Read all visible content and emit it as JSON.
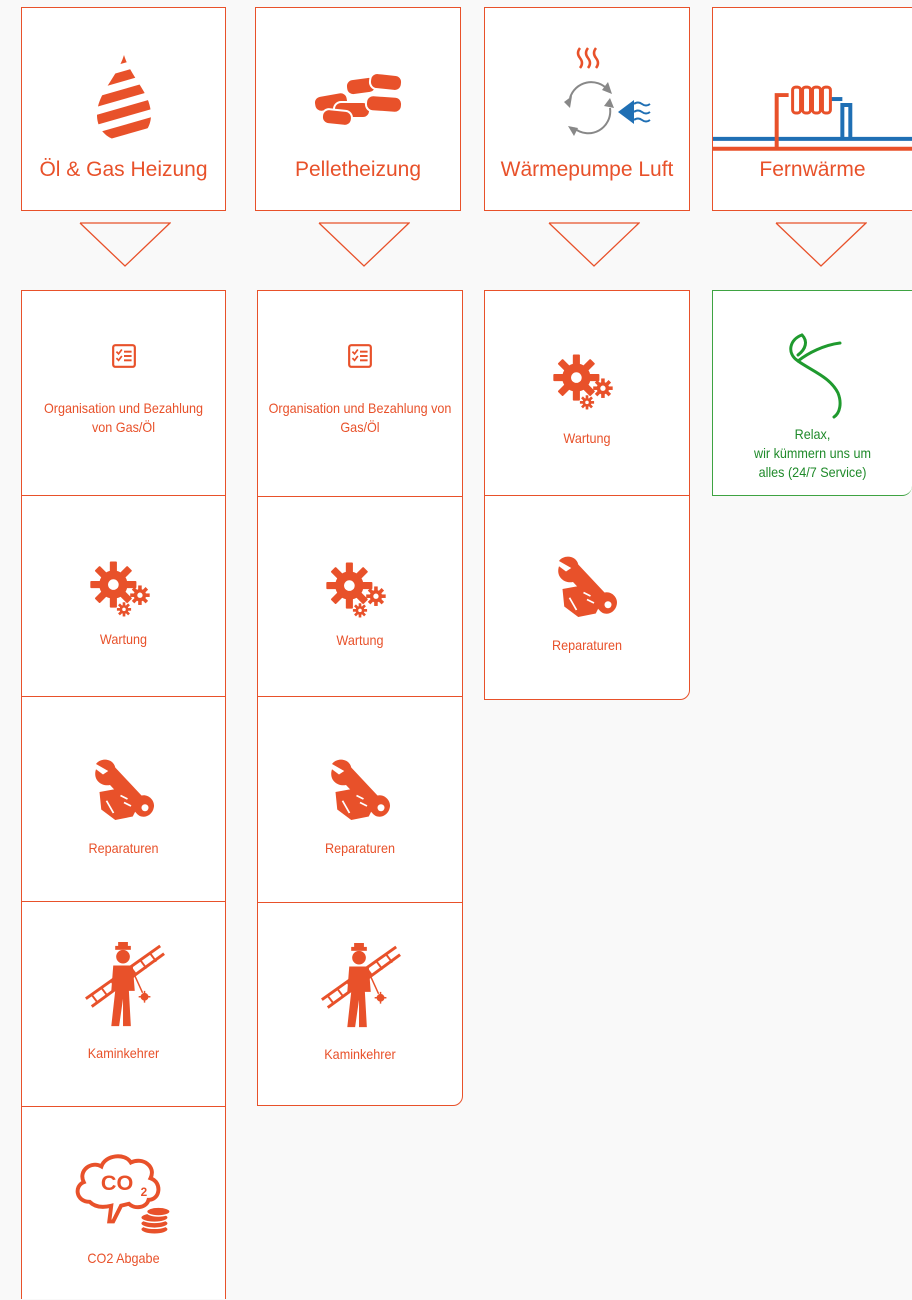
{
  "colors": {
    "accent": "#e8512a",
    "green": "#1f8a2a",
    "blue": "#1f6fb4"
  },
  "headers": [
    {
      "label": "Öl & Gas Heizung",
      "icon": "oil-drop-icon"
    },
    {
      "label": "Pelletheizung",
      "icon": "pellets-icon"
    },
    {
      "label": "Wärmepumpe Luft",
      "icon": "heat-pump-icon"
    },
    {
      "label": "Fernwärme",
      "icon": "district-heating-icon"
    }
  ],
  "services": {
    "organisation": "Organisation und Bezahlung von Gas/Öl",
    "wartung": "Wartung",
    "reparaturen": "Reparaturen",
    "kaminkehrer": "Kaminkehrer",
    "co2": "CO2 Abgabe",
    "relax": "Relax,\nwir kümmern uns um\nalles (24/7 Service)"
  }
}
